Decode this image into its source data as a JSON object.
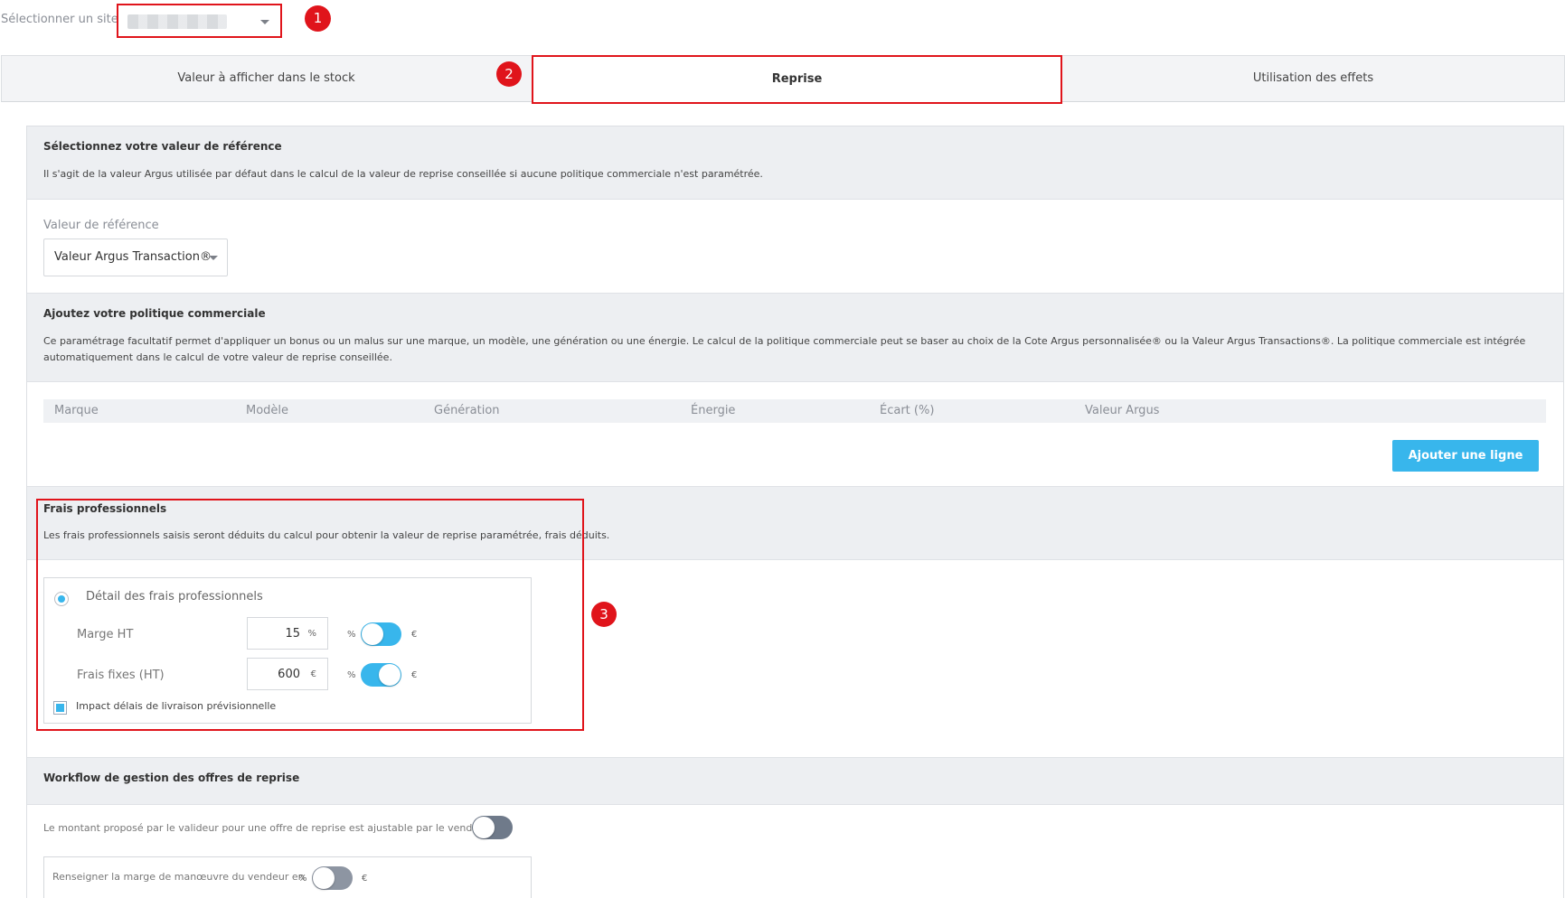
{
  "site": {
    "label": "Sélectionner un site"
  },
  "badges": [
    "1",
    "2",
    "3"
  ],
  "tabs": [
    {
      "label": "Valeur à afficher dans le stock"
    },
    {
      "label": "Reprise"
    },
    {
      "label": "Utilisation des effets"
    }
  ],
  "reference": {
    "title": "Sélectionnez votre valeur de référence",
    "description": "Il s'agit de la valeur Argus utilisée par défaut dans le calcul de la valeur de reprise conseillée si aucune politique commerciale n'est paramétrée.",
    "field_label": "Valeur de référence",
    "selected": "Valeur Argus Transaction®"
  },
  "policy": {
    "title": "Ajoutez votre politique commerciale",
    "description": "Ce paramétrage facultatif permet d'appliquer un bonus ou un malus sur une marque, un modèle, une génération ou une énergie. Le calcul de la politique commerciale peut se baser au choix de la Cote Argus personnalisée® ou la Valeur Argus Transactions®. La politique commerciale est intégrée automatiquement dans le calcul de votre valeur de reprise conseillée.",
    "columns": [
      "Marque",
      "Modèle",
      "Génération",
      "Énergie",
      "Écart (%)",
      "Valeur Argus"
    ],
    "add_button": "Ajouter une ligne"
  },
  "fees": {
    "title": "Frais professionnels",
    "description": "Les frais professionnels saisis seront déduits du calcul pour obtenir la valeur de reprise paramétrée, frais déduits.",
    "radio_label": "Détail des frais professionnels",
    "rows": [
      {
        "label": "Marge HT",
        "value": "15",
        "unit": "%",
        "left_unit": "%",
        "right_unit": "€",
        "toggle_on": false
      },
      {
        "label": "Frais fixes (HT)",
        "value": "600",
        "unit": "€",
        "left_unit": "%",
        "right_unit": "€",
        "toggle_on": true
      }
    ],
    "checkbox_label": "Impact délais de livraison prévisionnelle"
  },
  "workflow": {
    "title": "Workflow de gestion des offres de reprise",
    "adjustable_text": "Le montant proposé par le valideur pour une offre de reprise est ajustable par le vendeur",
    "margin_text": "Renseigner la marge de manœuvre du vendeur en",
    "margin_left_unit": "%",
    "margin_right_unit": "€"
  },
  "colors": {
    "accent": "#38b6ec",
    "highlight": "#e0141b",
    "section_bg": "#edeff2"
  }
}
